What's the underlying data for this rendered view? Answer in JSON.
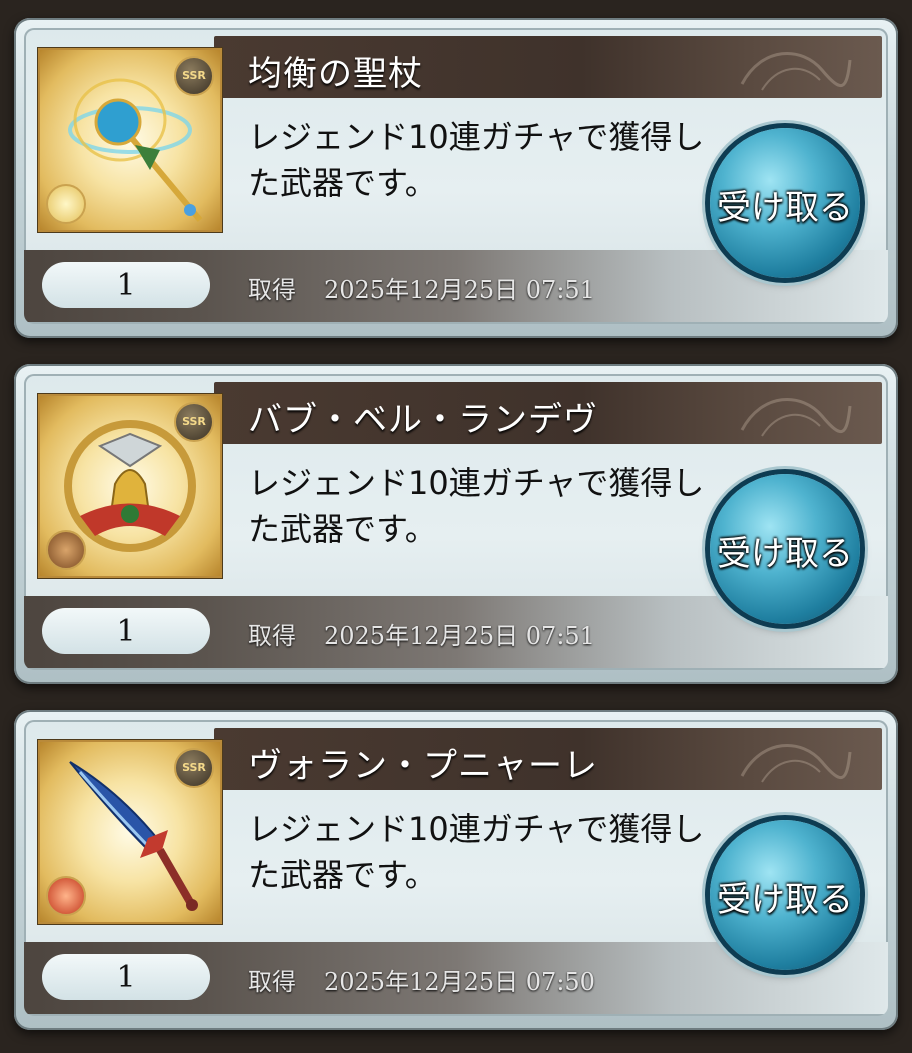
{
  "items": [
    {
      "name": "均衡の聖杖",
      "description": "レジェンド10連ガチャで獲得した武器です。",
      "quantity": "1",
      "acquired_label": "取得",
      "acquired_at": "2025年12月25日 07:51",
      "rarity": "SSR",
      "element_icon": "light-element-icon",
      "claim_label": "受け取る"
    },
    {
      "name": "バブ・ベル・ランデヴ",
      "description": "レジェンド10連ガチャで獲得した武器です。",
      "quantity": "1",
      "acquired_label": "取得",
      "acquired_at": "2025年12月25日 07:51",
      "rarity": "SSR",
      "element_icon": "earth-element-icon",
      "claim_label": "受け取る"
    },
    {
      "name": "ヴォラン・プニャーレ",
      "description": "レジェンド10連ガチャで獲得した武器です。",
      "quantity": "1",
      "acquired_label": "取得",
      "acquired_at": "2025年12月25日 07:50",
      "rarity": "SSR",
      "element_icon": "fire-element-icon",
      "claim_label": "受け取る"
    }
  ]
}
